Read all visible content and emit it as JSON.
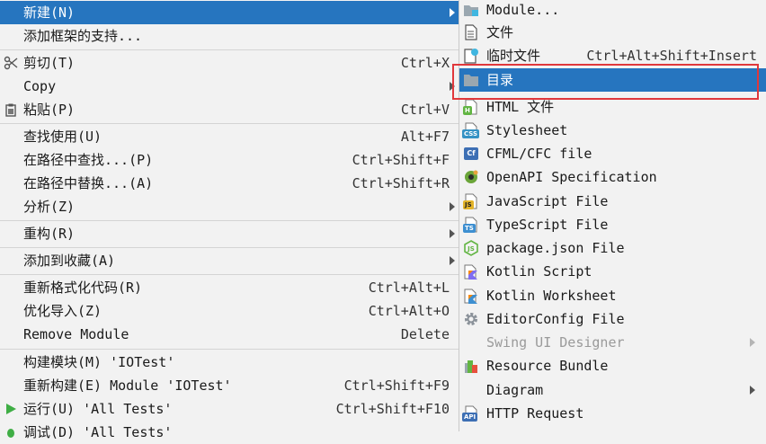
{
  "main_menu": {
    "new": {
      "label": "新建(N)"
    },
    "add_framework": {
      "label": "添加框架的支持..."
    },
    "cut": {
      "label": "剪切(T)",
      "shortcut": "Ctrl+X"
    },
    "copy": {
      "label": "Copy"
    },
    "paste": {
      "label": "粘贴(P)",
      "shortcut": "Ctrl+V"
    },
    "find_usages": {
      "label": "查找使用(U)",
      "shortcut": "Alt+F7"
    },
    "find_in_path": {
      "label": "在路径中查找...(P)",
      "shortcut": "Ctrl+Shift+F"
    },
    "replace_in_path": {
      "label": "在路径中替换...(A)",
      "shortcut": "Ctrl+Shift+R"
    },
    "analyze": {
      "label": "分析(Z)"
    },
    "refactor": {
      "label": "重构(R)"
    },
    "add_to_favorites": {
      "label": "添加到收藏(A)"
    },
    "reformat_code": {
      "label": "重新格式化代码(R)",
      "shortcut": "Ctrl+Alt+L"
    },
    "optimize_imports": {
      "label": "优化导入(Z)",
      "shortcut": "Ctrl+Alt+O"
    },
    "remove_module": {
      "label": "Remove Module",
      "shortcut": "Delete"
    },
    "build_module": {
      "label": "构建模块(M) 'IOTest'"
    },
    "rebuild_module": {
      "label": "重新构建(E) Module 'IOTest'",
      "shortcut": "Ctrl+Shift+F9"
    },
    "run_tests": {
      "label": "运行(U) 'All Tests'",
      "shortcut": "Ctrl+Shift+F10"
    },
    "debug_tests": {
      "label": "调试(D) 'All Tests'"
    }
  },
  "sub_menu": {
    "module": {
      "label": "Module..."
    },
    "file": {
      "label": "文件"
    },
    "scratch_file": {
      "label": "临时文件",
      "shortcut": "Ctrl+Alt+Shift+Insert"
    },
    "directory": {
      "label": "目录"
    },
    "html_file": {
      "label": "HTML 文件"
    },
    "stylesheet": {
      "label": "Stylesheet"
    },
    "cfml_file": {
      "label": "CFML/CFC file"
    },
    "openapi": {
      "label": "OpenAPI Specification"
    },
    "javascript_file": {
      "label": "JavaScript File"
    },
    "typescript_file": {
      "label": "TypeScript File"
    },
    "package_json": {
      "label": "package.json File"
    },
    "kotlin_script": {
      "label": "Kotlin Script"
    },
    "kotlin_worksheet": {
      "label": "Kotlin Worksheet"
    },
    "editorconfig": {
      "label": "EditorConfig File"
    },
    "swing_designer": {
      "label": "Swing UI Designer"
    },
    "resource_bundle": {
      "label": "Resource Bundle"
    },
    "diagram": {
      "label": "Diagram"
    },
    "http_request": {
      "label": "HTTP Request"
    }
  },
  "icons": {
    "html": "H",
    "css": "CSS",
    "cfml": "Cf",
    "js": "JS",
    "ts": "TS",
    "api": "API"
  },
  "colors": {
    "selection": "#2675bf",
    "highlight_border": "#e0383c",
    "menu_bg": "#f2f2f2"
  }
}
